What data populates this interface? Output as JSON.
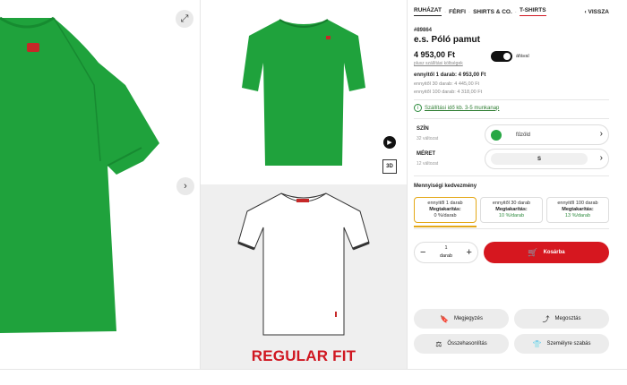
{
  "gallery": {
    "expand_icon": "expand-arrows-icon",
    "next_icon": "chevron-right-icon",
    "play_icon": "play-icon",
    "view3d_label": "3D",
    "fit_label": "REGULAR FIT",
    "shirt_color": "#1fa23c"
  },
  "breadcrumb": {
    "items": [
      "RUHÁZAT",
      "FÉRFI",
      "SHIRTS & CO.",
      "T-SHIRTS"
    ],
    "back_label": "VISSZA"
  },
  "product": {
    "sku": "#89864",
    "title": "e.s. Póló pamut",
    "price": "4 953,00 Ft",
    "shipping_link": "plusz szállítási költségek",
    "vat_label": "áfával",
    "price_line1": "ennyitől 1 darab: 4 953,00 Ft",
    "price_line2": "ennyitől 30 darab: 4 445,00 Ft",
    "price_line3": "ennyitől 100 darab: 4 318,00 Ft",
    "delivery": "Szállítási idő kb. 3-5 munkanap"
  },
  "options": {
    "color_label": "SZÍN",
    "color_count": "32 változat",
    "color_value": "fűzöld",
    "color_hex": "#27a744",
    "size_label": "MÉRET",
    "size_count": "12 változat",
    "size_value": "S"
  },
  "discount": {
    "title": "Mennyiségi kedvezmény",
    "tiers": [
      {
        "qty": "ennyitől 1 darab",
        "label": "Megtakarítás:",
        "value": "0 %/darab"
      },
      {
        "qty": "ennyitől 30 darab",
        "label": "Megtakarítás:",
        "value": "10 %/darab"
      },
      {
        "qty": "ennyitől 100 darab",
        "label": "Megtakarítás:",
        "value": "13 %/darab"
      }
    ]
  },
  "purchase": {
    "minus": "−",
    "plus": "+",
    "quantity": "1",
    "unit": "darab",
    "cart_label": "Kosárba"
  },
  "actions": {
    "note": "Megjegyzés",
    "share": "Megosztás",
    "compare": "Összehasonlítás",
    "custom": "Személyre szabás"
  },
  "colors": {
    "accent_red": "#d6171f",
    "active_tier": "#e4a818",
    "green": "#27a744"
  }
}
